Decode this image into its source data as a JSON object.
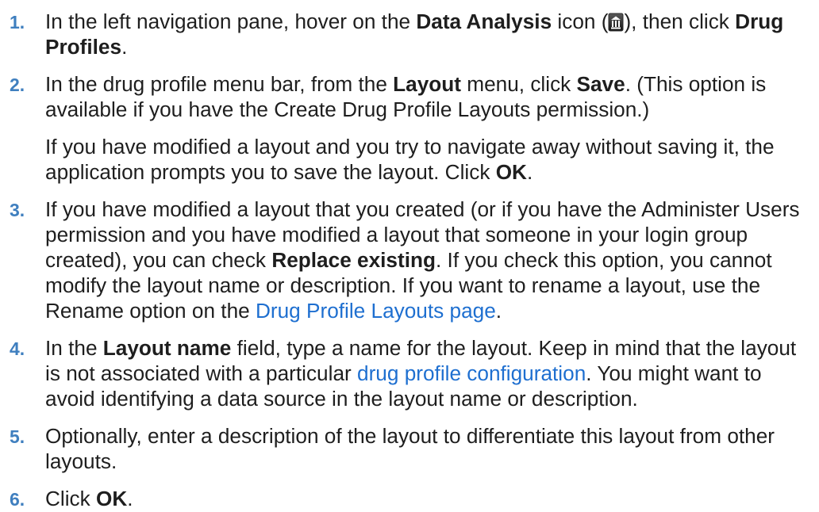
{
  "colors": {
    "text": "#1e1e1e",
    "step_number": "#3f7fbf",
    "link": "#1e6fd0",
    "background": "#ffffff"
  },
  "icons": {
    "data_analysis": "data-analysis-icon"
  },
  "steps": [
    {
      "number": "1.",
      "lines": [
        [
          "In the left navigation pane, hover on the ",
          "Data Analysis",
          " icon (",
          "), then click ",
          "Drug"
        ],
        [
          "Profiles",
          "."
        ]
      ]
    },
    {
      "number": "2.",
      "lines": [
        [
          "In the drug profile menu bar, from the ",
          "Layout",
          " menu, click ",
          "Save",
          ". (This option is"
        ],
        [
          "available if you have the Create Drug Profile Layouts permission.)"
        ]
      ],
      "note": [
        [
          "If you have modified a layout and you try to navigate away without saving it, the"
        ],
        [
          "application prompts you to save the layout. Click ",
          "OK",
          "."
        ]
      ]
    },
    {
      "number": "3.",
      "lines": [
        [
          "If you have modified a layout that you created (or if you have the Administer Users"
        ],
        [
          "permission and you have modified a layout that someone in your login group"
        ],
        [
          "created), you can check ",
          "Replace existing",
          ". If you check this option, you cannot"
        ],
        [
          "modify the layout name or description. If you want to rename a layout, use the"
        ],
        [
          "Rename option on the ",
          "Drug Profile Layouts page",
          "."
        ]
      ]
    },
    {
      "number": "4.",
      "lines": [
        [
          "In the ",
          "Layout name",
          " field, type a name for the layout. Keep in mind that the layout"
        ],
        [
          "is not associated with a particular ",
          "drug profile configuration",
          ". You might want to"
        ],
        [
          "avoid identifying a data source in the layout name or description."
        ]
      ]
    },
    {
      "number": "5.",
      "lines": [
        [
          "Optionally, enter a description of the layout to differentiate this layout from other"
        ],
        [
          "layouts."
        ]
      ]
    },
    {
      "number": "6.",
      "lines": [
        [
          "Click ",
          "OK",
          "."
        ]
      ]
    }
  ]
}
